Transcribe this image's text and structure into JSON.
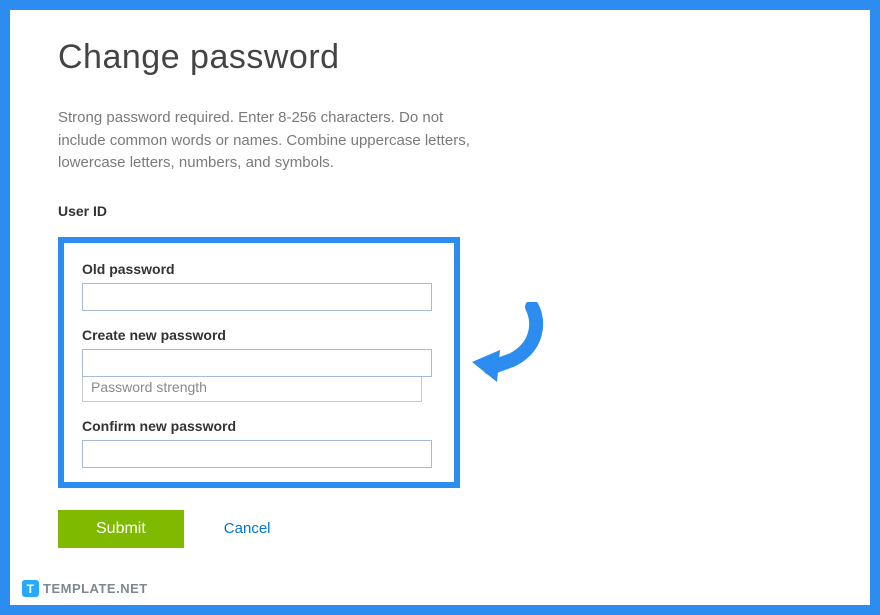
{
  "page": {
    "title": "Change password",
    "instruction": "Strong password required. Enter 8-256 characters. Do not include common words or names. Combine uppercase letters, lowercase letters, numbers, and symbols.",
    "userid_label": "User ID"
  },
  "fields": {
    "old_password": {
      "label": "Old password",
      "value": ""
    },
    "new_password": {
      "label": "Create new password",
      "value": "",
      "strength_text": "Password strength"
    },
    "confirm_password": {
      "label": "Confirm new password",
      "value": ""
    }
  },
  "buttons": {
    "submit": "Submit",
    "cancel": "Cancel"
  },
  "watermark": {
    "badge": "T",
    "text": "TEMPLATE.NET"
  },
  "colors": {
    "accent_blue": "#2d8cf0",
    "submit_green": "#7fba00",
    "link_blue": "#0078d4"
  }
}
